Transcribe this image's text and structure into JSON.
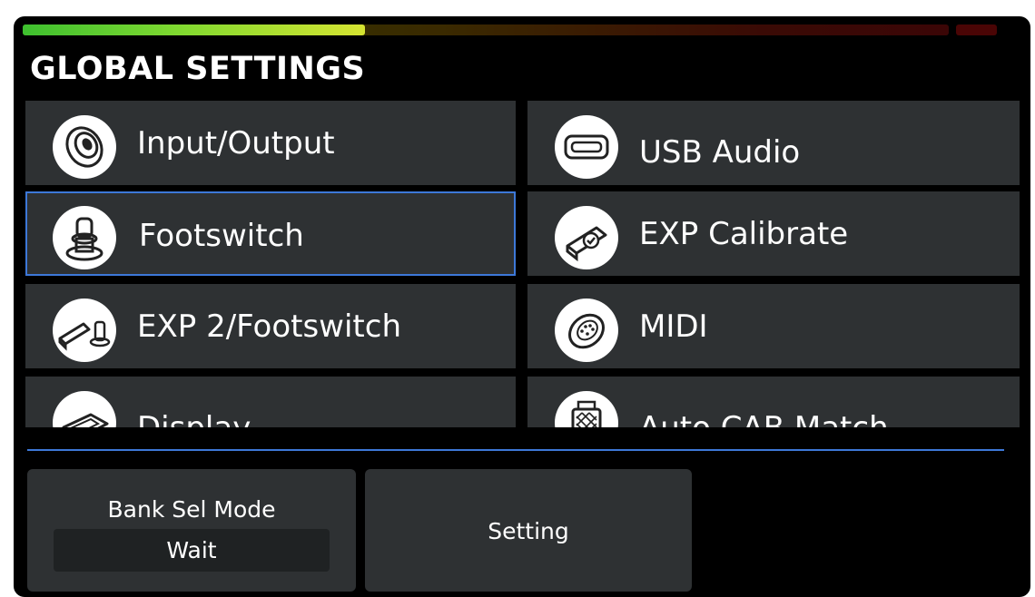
{
  "screen": {
    "title": "GLOBAL SETTINGS",
    "input_level": 0.37
  },
  "menu": [
    {
      "label": "Input/Output",
      "icon": "jack-icon"
    },
    {
      "label": "USB Audio",
      "icon": "usb-port-icon"
    },
    {
      "label": "Footswitch",
      "icon": "footswitch-icon"
    },
    {
      "label": "EXP Calibrate",
      "icon": "expression-pedal-check-icon"
    },
    {
      "label": "EXP 2/Footswitch",
      "icon": "pedal-footswitch-icon"
    },
    {
      "label": "MIDI",
      "icon": "midi-port-icon"
    },
    {
      "label": "Display",
      "icon": "display-icon"
    },
    {
      "label": "Auto CAB Match",
      "icon": "cab-icon"
    }
  ],
  "selected_item": "Footswitch",
  "knobs": {
    "bank_sel_label": "Bank Sel Mode",
    "bank_sel_value": "Wait",
    "setting_label": "Setting"
  },
  "colors": {
    "panel": "#2e3133",
    "accent": "#3d78d8",
    "background": "#000000"
  }
}
